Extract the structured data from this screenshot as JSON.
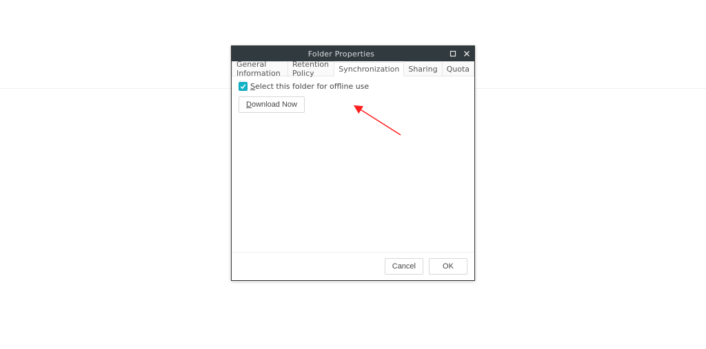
{
  "dialog": {
    "title": "Folder Properties",
    "tabs": {
      "general": {
        "label": "General Information"
      },
      "retention": {
        "label": "Retention Policy"
      },
      "sync": {
        "label": "Synchronization"
      },
      "sharing": {
        "label": "Sharing"
      },
      "quota": {
        "label": "Quota"
      }
    },
    "sync_tab": {
      "checkbox_label_prefix": "S",
      "checkbox_label_rest": "elect this folder for offline use",
      "download_accel": "D",
      "download_rest": "ownload Now"
    },
    "buttons": {
      "cancel": "Cancel",
      "ok": "OK"
    }
  }
}
